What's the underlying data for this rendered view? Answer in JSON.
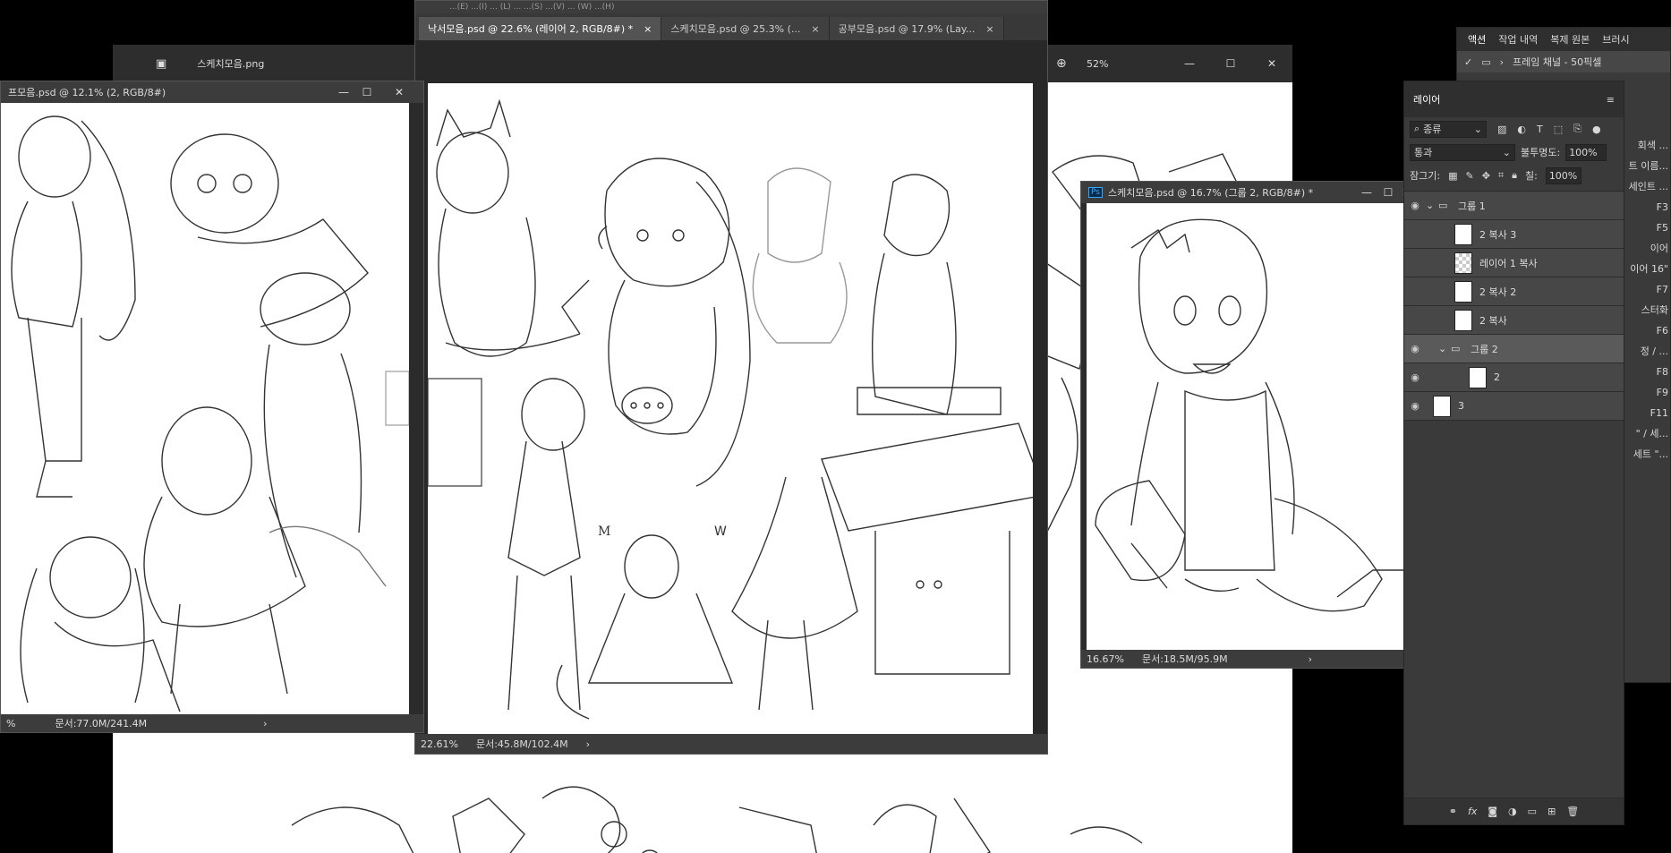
{
  "behind_window": {
    "title": "스케치모음.png",
    "zoom": "52%",
    "icons": [
      "image-icon",
      "zoom-icon",
      "minimize-icon",
      "maximize-icon",
      "close-icon"
    ]
  },
  "left_window": {
    "title": "프모음.psd @ 12.1% (2, RGB/8#)",
    "status_zoom": "%",
    "status_doc": "문서:77.0M/241.4M",
    "status_arrow": "›"
  },
  "center_window": {
    "title_fragment": "...(E) ...(I) ... (L) ... ...(S) ...(V) ... (W) ...(H)",
    "tabs": [
      {
        "label": "낙서모음.psd @ 22.6% (레이어 2, RGB/8#) *",
        "close": "×"
      },
      {
        "label": "스케치모음.psd @ 25.3% (...",
        "close": "×"
      },
      {
        "label": "공부모음.psd @ 17.9% (Lay...",
        "close": "×"
      }
    ],
    "status_zoom": "22.61%",
    "status_doc": "문서:45.8M/102.4M",
    "status_arrow": "›"
  },
  "right_window": {
    "badge": "Ps",
    "title": "스케치모음.psd @ 16.7% (그룹 2, RGB/8#) *",
    "status_zoom": "16.67%",
    "status_doc": "문서:18.5M/95.9M",
    "status_arrow": "›"
  },
  "actions_panel": {
    "tabs": [
      "액션",
      "작업 내역",
      "복제 원본",
      "브러시"
    ],
    "first_item": "프레임 채널 - 50픽셀",
    "side_items": [
      "회색 ...",
      "트 이름...",
      "세인트 ...",
      "F3",
      "F5",
      "이어",
      "이어 16\"",
      "F7",
      "스터화",
      "F6",
      "정 / ...",
      "F8",
      "F9",
      "F11",
      "\" / 세...",
      "세트 \"..."
    ]
  },
  "layers_panel": {
    "title": "레이어",
    "filter_label": "종류",
    "blend_mode": "통과",
    "opacity_label": "불투명도:",
    "opacity_value": "100%",
    "lock_label": "잠그기:",
    "fill_label": "칠:",
    "fill_value": "100%",
    "layers": [
      {
        "name": "그룹 1",
        "type": "group",
        "visible": true,
        "indent": 0
      },
      {
        "name": "2 복사 3",
        "type": "layer",
        "visible": false,
        "indent": 1
      },
      {
        "name": "레이어 1 복사",
        "type": "layer",
        "visible": false,
        "indent": 1
      },
      {
        "name": "2 복사 2",
        "type": "layer",
        "visible": false,
        "indent": 1
      },
      {
        "name": "2 복사",
        "type": "layer",
        "visible": false,
        "indent": 1
      },
      {
        "name": "그룹 2",
        "type": "group",
        "visible": true,
        "indent": 1,
        "selected": true
      },
      {
        "name": "2",
        "type": "layer",
        "visible": true,
        "indent": 2
      },
      {
        "name": "3",
        "type": "layer",
        "visible": true,
        "indent": 0
      }
    ],
    "footer_icons": [
      "link-icon",
      "fx-icon",
      "mask-icon",
      "adjustment-icon",
      "folder-icon",
      "new-layer-icon",
      "trash-icon"
    ],
    "fx_label": "fx"
  },
  "colors": {
    "window_bar": "#3c3c3c",
    "panel_bg": "#3a3a3a",
    "selected_row": "#5a5a5a",
    "canvas": "#ffffff"
  }
}
